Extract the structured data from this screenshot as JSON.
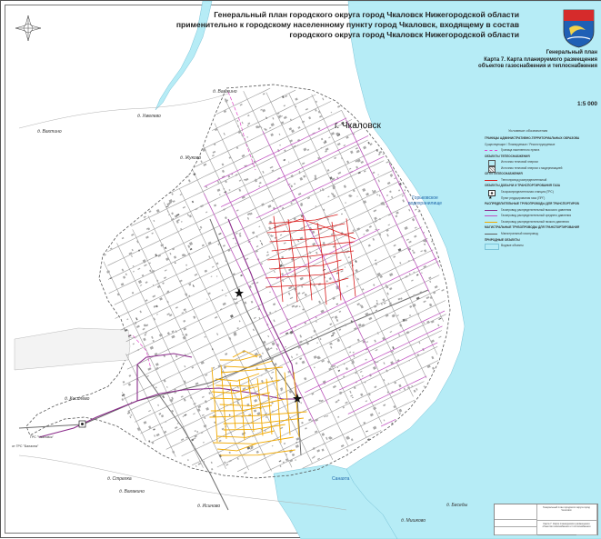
{
  "title": {
    "line1": "Генеральный план городского округа город Чкаловск Нижегородской области",
    "line2": "применительно к городскому населенному пункту город Чкаловск, входящему в состав",
    "line3": "городского округа город Чкаловск Нижегородской области"
  },
  "subtitle": {
    "line1": "Генеральный план",
    "line2": "Карта 7. Карта планируемого размещения",
    "line3": "объектов газоснабжения и теплоснабжения"
  },
  "scale": "1:5 000",
  "city_label": "г. Чкаловск",
  "water": {
    "reservoir_line1": "Горьковское",
    "reservoir_line2": "водохранилище",
    "river": "Санахта"
  },
  "settlements": [
    "д. Вашкино",
    "д. Вахтино",
    "д. Хмелево",
    "д. Жуково",
    "д. Кисилево",
    "д. Стрелка",
    "д. Валакино",
    "д. Исиново",
    "д. Мишково",
    "д. Беседы"
  ],
  "facilities": {
    "grs": "ГРС \"Чкаловск\"",
    "from_grs": "от ГРС \"Балахна\""
  },
  "legend": {
    "title": "Условные обозначения",
    "items": [
      {
        "text": "ГРАНИЦЫ АДМИНИСТРАТИВНО-ТЕРРИТОРИАЛЬНЫХ ОБРАЗОВАНИЙ",
        "type": "header"
      },
      {
        "text": "Существующие / Планируемые / Реконструируемые",
        "type": "note"
      },
      {
        "text": "Граница населенного пункта",
        "type": "boundary",
        "color": "#e040c8"
      },
      {
        "text": "ОБЪЕКТЫ ТЕПЛОСНАБЖЕНИЯ",
        "type": "header"
      },
      {
        "text": "Источник тепловой энергии",
        "type": "box",
        "color": "#555555"
      },
      {
        "text": "Источник тепловой энергии с модернизацией",
        "type": "box-hatch",
        "color": "#555555"
      },
      {
        "text": "СЕТИ ТЕПЛОСНАБЖЕНИЯ",
        "type": "header"
      },
      {
        "text": "Теплопровод распределительный",
        "type": "line",
        "color": "#d81b1b"
      },
      {
        "text": "ОБЪЕКТЫ ДОБЫЧИ И ТРАНСПОРТИРОВАНИЯ ГАЗА",
        "type": "header"
      },
      {
        "text": "Газораспределительная станция (ГРС)",
        "type": "box-dot",
        "color": "#333333"
      },
      {
        "text": "Пункт редуцирования газа (ПРГ)",
        "type": "star",
        "color": "#111111"
      },
      {
        "text": "РАСПРЕДЕЛИТЕЛЬНЫЕ ТРУБОПРОВОДЫ ДЛЯ ТРАНСПОРТИРОВАНИЯ ГАЗА",
        "type": "header"
      },
      {
        "text": "Газопровод распределительный высокого давления",
        "type": "line",
        "color": "#8a2a8a"
      },
      {
        "text": "Газопровод распределительный среднего давления",
        "type": "line",
        "color": "#c050c0"
      },
      {
        "text": "Газопровод распределительный низкого давления",
        "type": "line",
        "color": "#f0a800"
      },
      {
        "text": "МАГИСТРАЛЬНЫЕ ТРУБОПРОВОДЫ ДЛЯ ТРАНСПОРТИРОВАНИЯ ЖИДКИХ И ГАЗООБРАЗНЫХ УГЛЕВОДОРОДОВ",
        "type": "header"
      },
      {
        "text": "Магистральный газопровод",
        "type": "line",
        "color": "#606060"
      },
      {
        "text": "ПРИРОДНЫЕ ОБЪЕКТЫ",
        "type": "header"
      },
      {
        "text": "Водные объекты",
        "type": "fill",
        "color": "#b6ecf6"
      }
    ]
  },
  "colors": {
    "water": "#b6ecf6",
    "boundary": "#e040c8",
    "gas_high": "#8a2a8a",
    "gas_mid": "#c050c0",
    "gas_low": "#f0a800",
    "heat": "#d81b1b",
    "road": "#6d6d6d",
    "building": "#9a9a9a"
  },
  "icons": {
    "coat_of_arms": "coat-of-arms-icon",
    "compass": "compass-rose-icon"
  },
  "stamp": {
    "name": "Генеральный план городского округа город Чкаловск",
    "sheet": "Карта 7. Карта планируемого размещения объектов газоснабжения и теплоснабжения"
  }
}
